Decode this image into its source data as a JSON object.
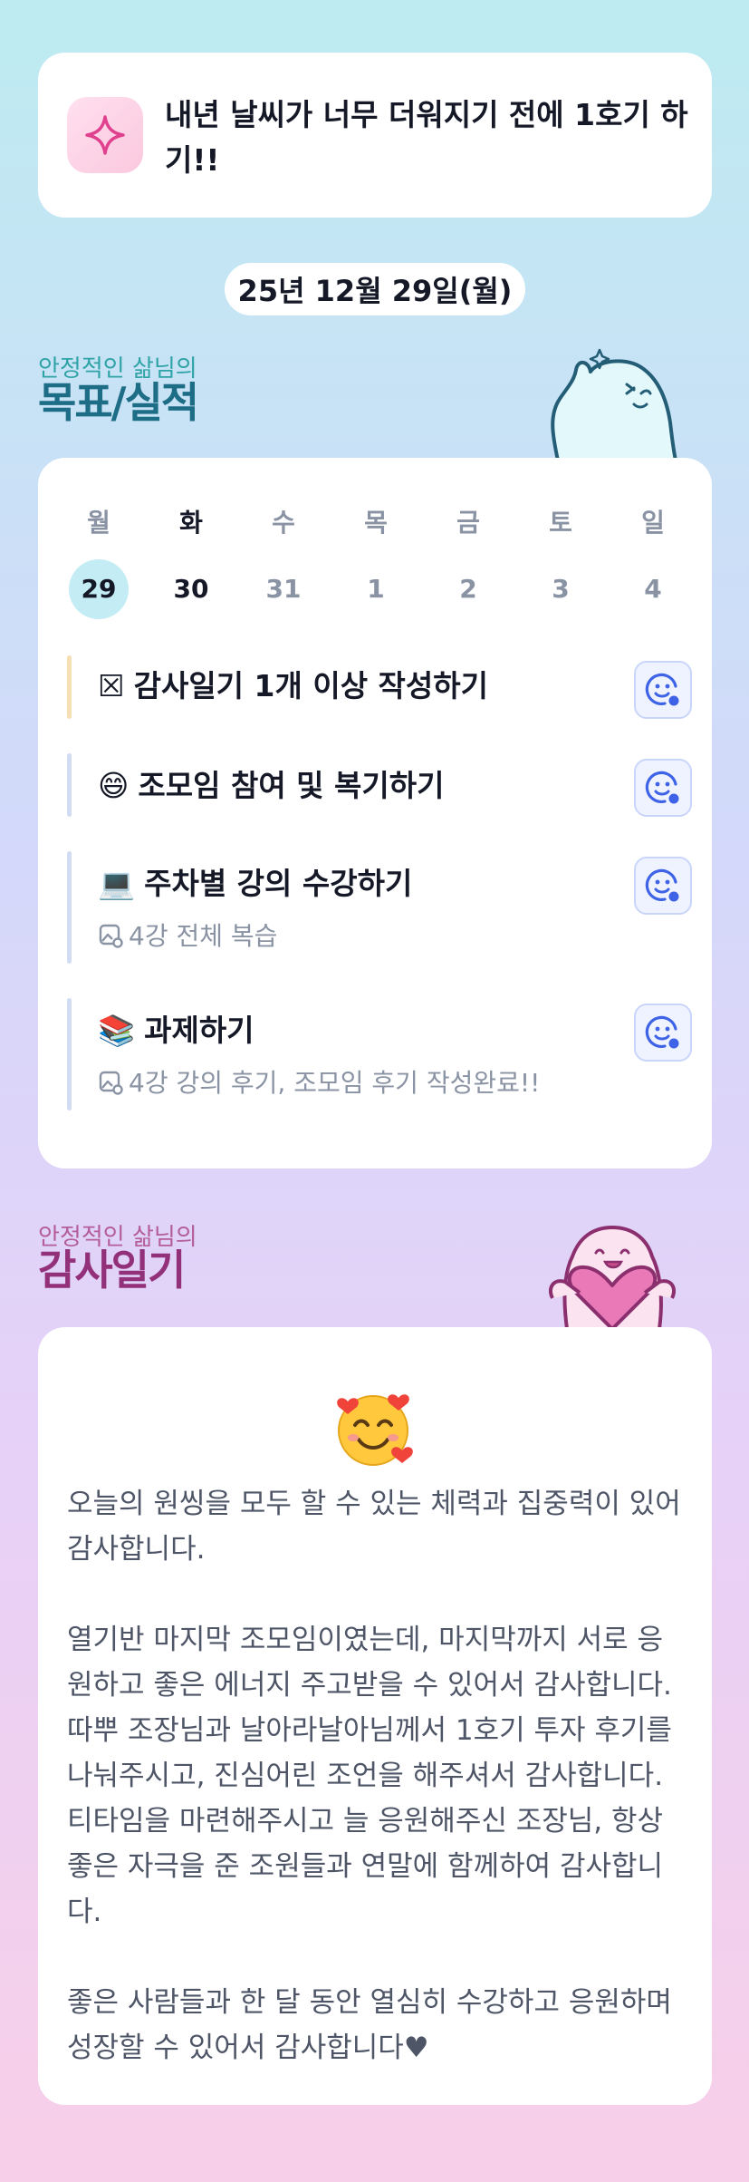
{
  "goal": {
    "icon": "sparkle-icon",
    "text": "내년 날씨가 너무 더워지기 전에 1호기 하기!!"
  },
  "date": "25년 12월 29일(월)",
  "goals_section": {
    "subtitle": "안정적인 삶님의",
    "title": "목표/실적",
    "mascot": "cyan-ghost-mascot"
  },
  "week": {
    "days": [
      {
        "name": "월",
        "num": "29",
        "state": "today"
      },
      {
        "name": "화",
        "num": "30",
        "state": "selected"
      },
      {
        "name": "수",
        "num": "31",
        "state": "past"
      },
      {
        "name": "목",
        "num": "1",
        "state": "future"
      },
      {
        "name": "금",
        "num": "2",
        "state": "future"
      },
      {
        "name": "토",
        "num": "3",
        "state": "future"
      },
      {
        "name": "일",
        "num": "4",
        "state": "future"
      }
    ]
  },
  "tasks": [
    {
      "emoji": "☒",
      "title": "감사일기 1개 이상 작성하기",
      "note": "",
      "bar_color": "#f7dfb4"
    },
    {
      "emoji": "😄",
      "title": "조모임 참여 및 복기하기",
      "note": "",
      "bar_color": "#d2dcf3"
    },
    {
      "emoji": "💻",
      "title": "주차별 강의 수강하기",
      "note": "4강 전체 복습",
      "bar_color": "#d2dcf3"
    },
    {
      "emoji": "📚",
      "title": "과제하기",
      "note": "4강 강의 후기, 조모임 후기 작성완료!!",
      "bar_color": "#d2dcf3"
    }
  ],
  "diary_section": {
    "subtitle": "안정적인 삶님의",
    "title": "감사일기",
    "mascot": "pink-ghost-heart-mascot"
  },
  "diary": {
    "emoji": "🥰",
    "text": "오늘의 원씽을 모두 할 수 있는 체력과 집중력이 있어 감사합니다.\n\n열기반 마지막 조모임이였는데, 마지막까지 서로 응원하고 좋은 에너지 주고받을 수 있어서 감사합니다. 따뿌 조장님과 날아라날아님께서 1호기 투자 후기를 나눠주시고, 진심어린 조언을 해주셔서 감사합니다. 티타임을 마련해주시고 늘 응원해주신 조장님, 항상 좋은 자극을 준 조원들과 연말에 함께하여 감사합니다.\n\n좋은 사람들과 한 달 동안 열심히 수강하고 응원하며 성장할 수 있어서 감사합니다♥"
  },
  "colors": {
    "accent_teal": "#1e6d86",
    "accent_pink": "#93307a",
    "today_bg": "#c4ecf4",
    "react_blue": "#3f63e6"
  }
}
